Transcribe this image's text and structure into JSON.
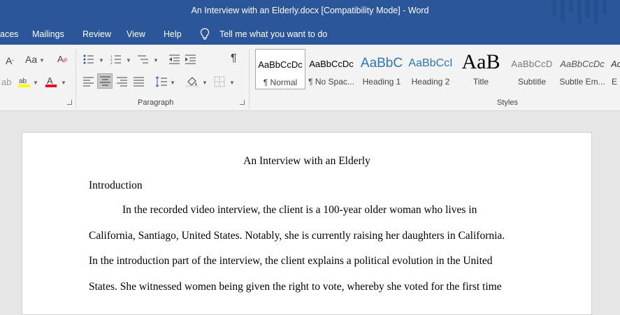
{
  "window": {
    "title": "An Interview with an Elderly.docx [Compatibility Mode]  -  Word"
  },
  "menu": {
    "items": [
      "aces",
      "Mailings",
      "Review",
      "View",
      "Help"
    ],
    "tell_me": "Tell me what you want to do"
  },
  "ribbon": {
    "paragraph_label": "Paragraph",
    "styles_label": "Styles",
    "font_case_label": "Aa",
    "styles": [
      {
        "sample": "AaBbCcDc",
        "name": "¶ Normal"
      },
      {
        "sample": "AaBbCcDc",
        "name": "¶ No Spac..."
      },
      {
        "sample": "AaBbC",
        "name": "Heading 1"
      },
      {
        "sample": "AaBbCcI",
        "name": "Heading 2"
      },
      {
        "sample": "AaB",
        "name": "Title"
      },
      {
        "sample": "AaBbCcD",
        "name": "Subtitle"
      },
      {
        "sample": "AaBbCcDc",
        "name": "Subtle Em..."
      },
      {
        "sample": "Ac",
        "name": "E"
      }
    ],
    "colors": {
      "highlight": "#ffff00",
      "font_color": "#e81123"
    }
  },
  "document": {
    "title": "An Interview with an Elderly",
    "heading": "Introduction",
    "lines": [
      "In the recorded video interview, the client is a 100-year older woman who lives in",
      "California, Santiago, United States. Notably, she is currently raising her daughters in California.",
      "In the introduction part of the interview, the client explains a political evolution in the United",
      "States. She witnessed women being given the right to vote, whereby she voted for the first time"
    ]
  },
  "theme": {
    "accent": "#2b579a",
    "ribbon_bg": "#f3f3f3",
    "canvas_bg": "#e6e6e6"
  }
}
